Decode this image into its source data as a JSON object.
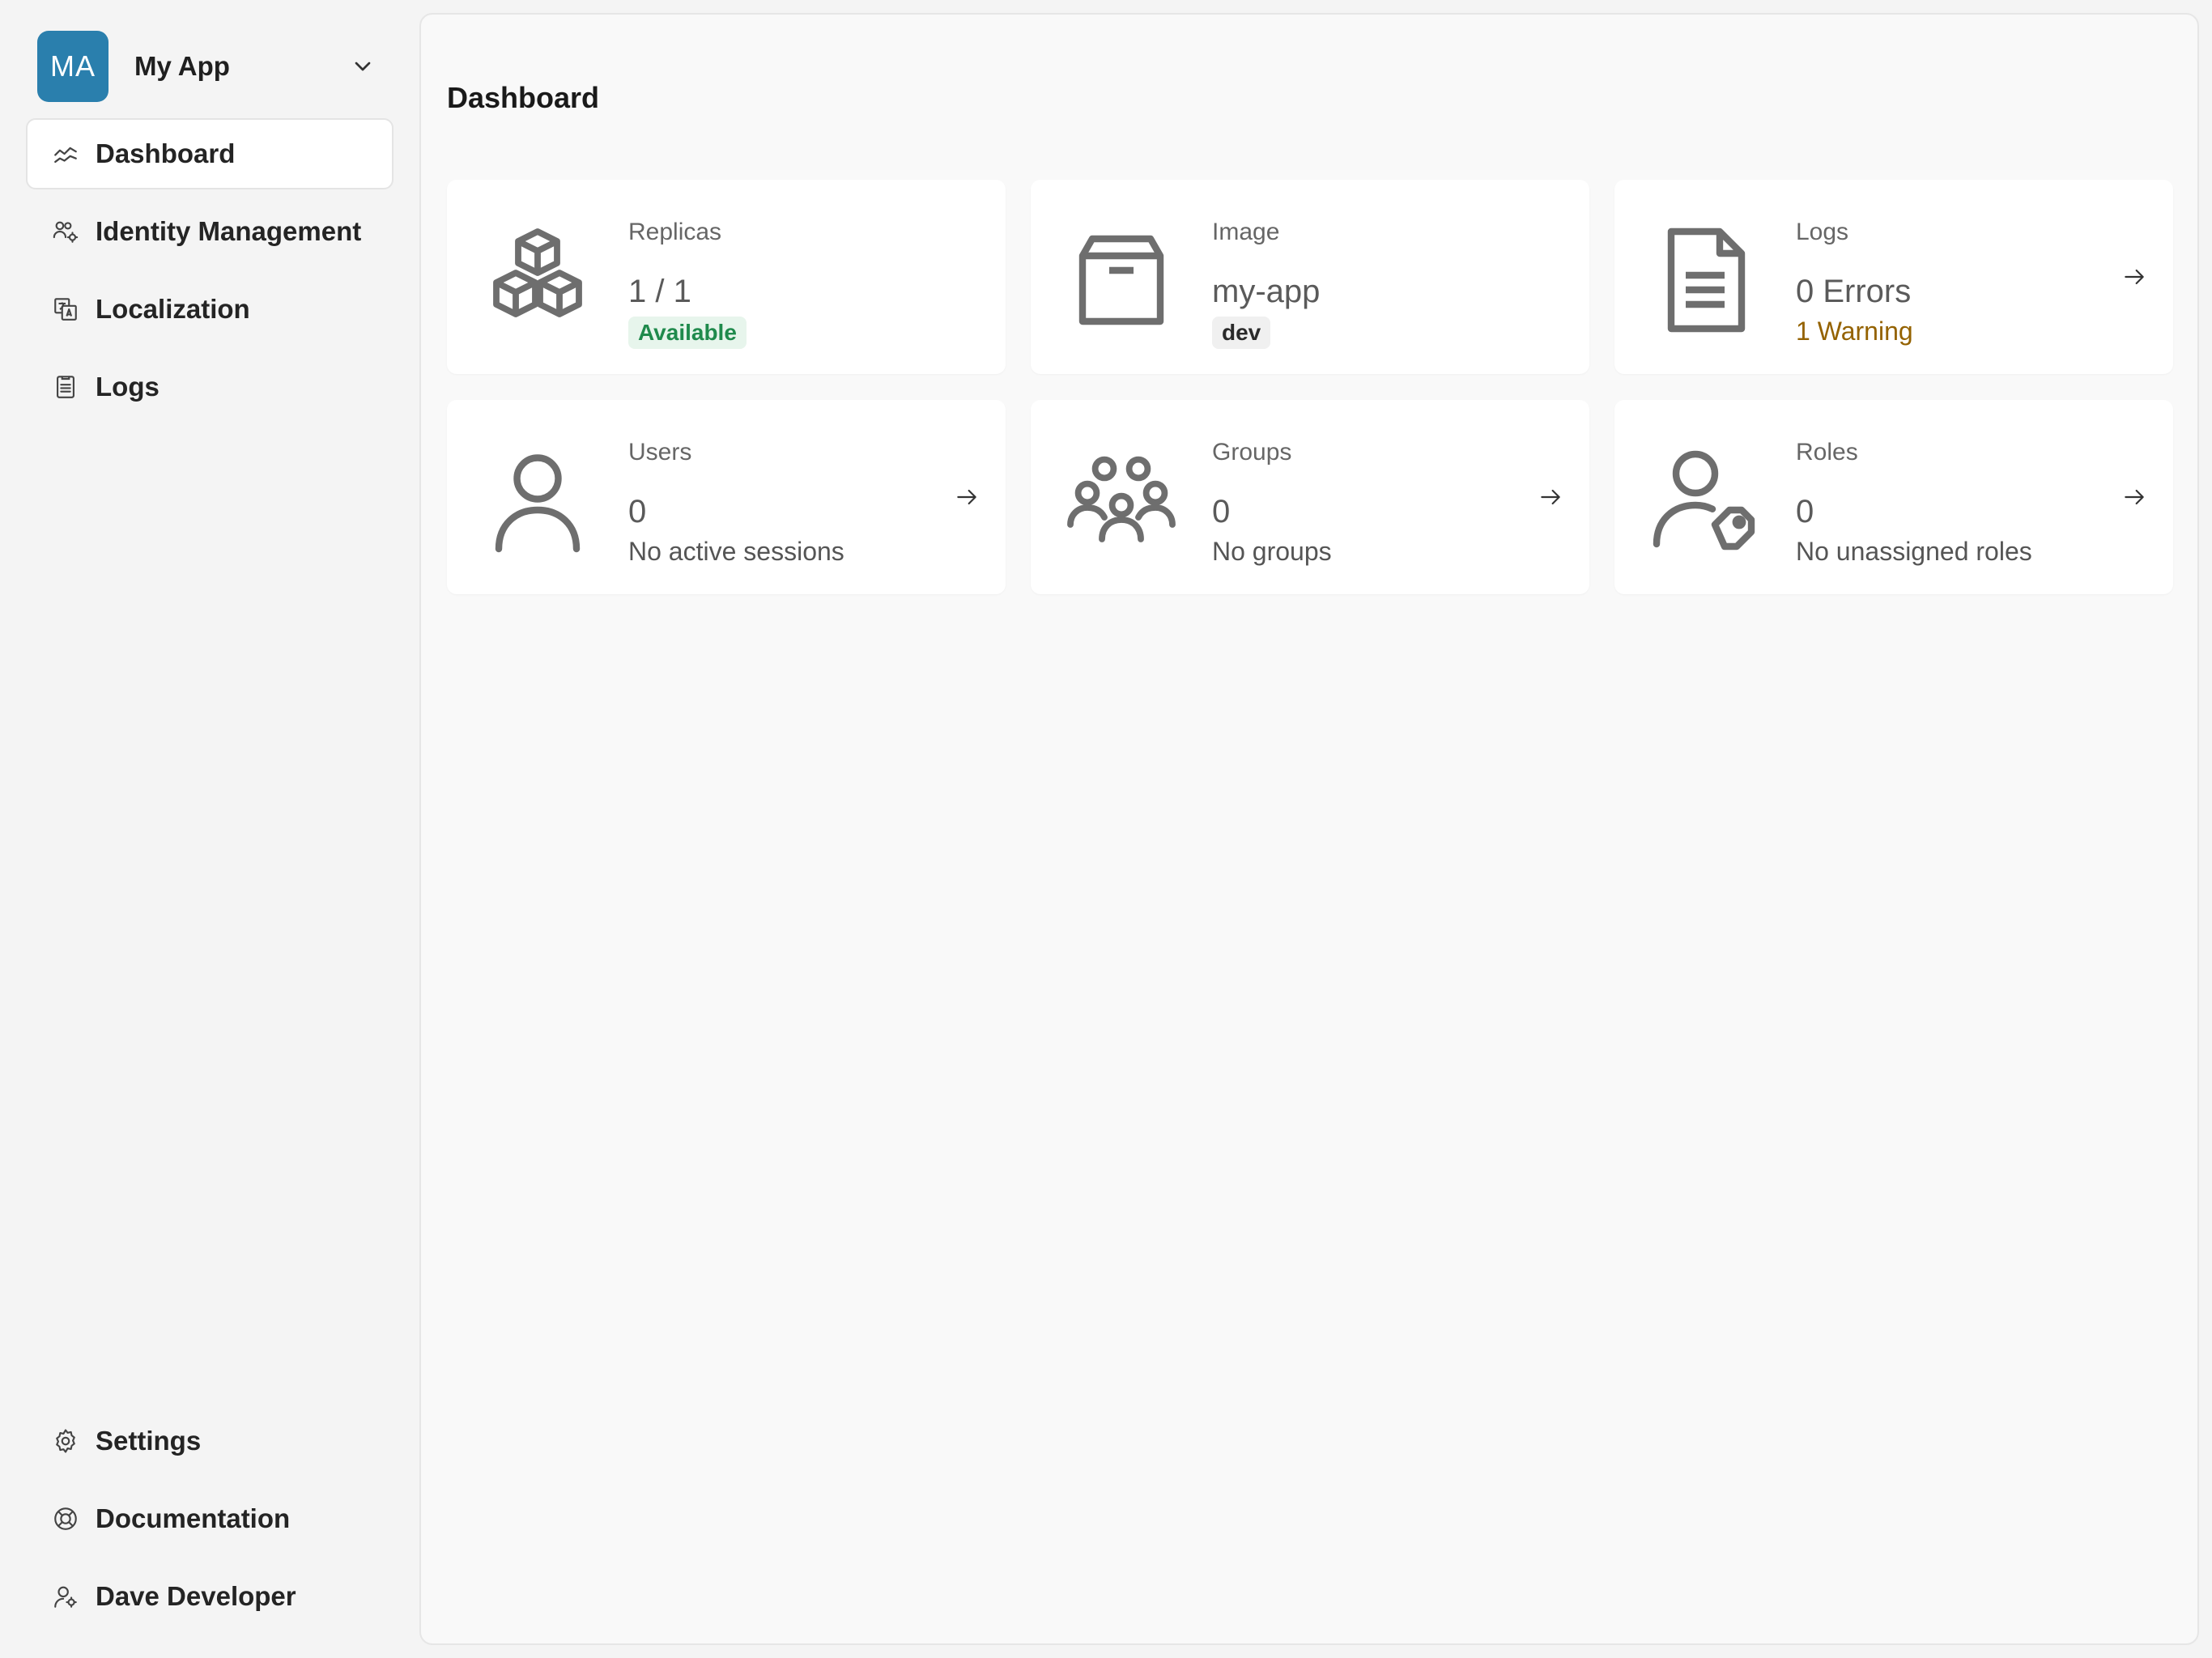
{
  "app": {
    "initials": "MA",
    "name": "My App",
    "accent": "#2a7fad"
  },
  "nav": {
    "items": [
      {
        "label": "Dashboard",
        "icon": "chart-line-icon",
        "active": true
      },
      {
        "label": "Identity Management",
        "icon": "users-gear-icon"
      },
      {
        "label": "Localization",
        "icon": "translate-icon"
      },
      {
        "label": "Logs",
        "icon": "clipboard-list-icon"
      }
    ],
    "bottom": [
      {
        "label": "Settings",
        "icon": "gear-icon"
      },
      {
        "label": "Documentation",
        "icon": "lifebuoy-icon"
      },
      {
        "label": "Dave Developer",
        "icon": "user-gear-icon"
      }
    ]
  },
  "page": {
    "title": "Dashboard"
  },
  "cards": {
    "replicas": {
      "label": "Replicas",
      "value": "1 / 1",
      "badge": "Available",
      "icon": "cubes-icon"
    },
    "image": {
      "label": "Image",
      "value": "my-app",
      "badge": "dev",
      "icon": "archive-box-icon"
    },
    "logs": {
      "label": "Logs",
      "value": "0 Errors",
      "sub": "1 Warning",
      "icon": "document-icon"
    },
    "users": {
      "label": "Users",
      "value": "0",
      "sub": "No active sessions",
      "icon": "user-icon"
    },
    "groups": {
      "label": "Groups",
      "value": "0",
      "sub": "No groups",
      "icon": "group-icon"
    },
    "roles": {
      "label": "Roles",
      "value": "0",
      "sub": "No unassigned roles",
      "icon": "user-tag-icon"
    }
  },
  "colors": {
    "available_text": "#1f8a4c",
    "available_bg": "#e7f5ec",
    "warning_text": "#946200",
    "icon_gray": "#6e6e6e"
  }
}
